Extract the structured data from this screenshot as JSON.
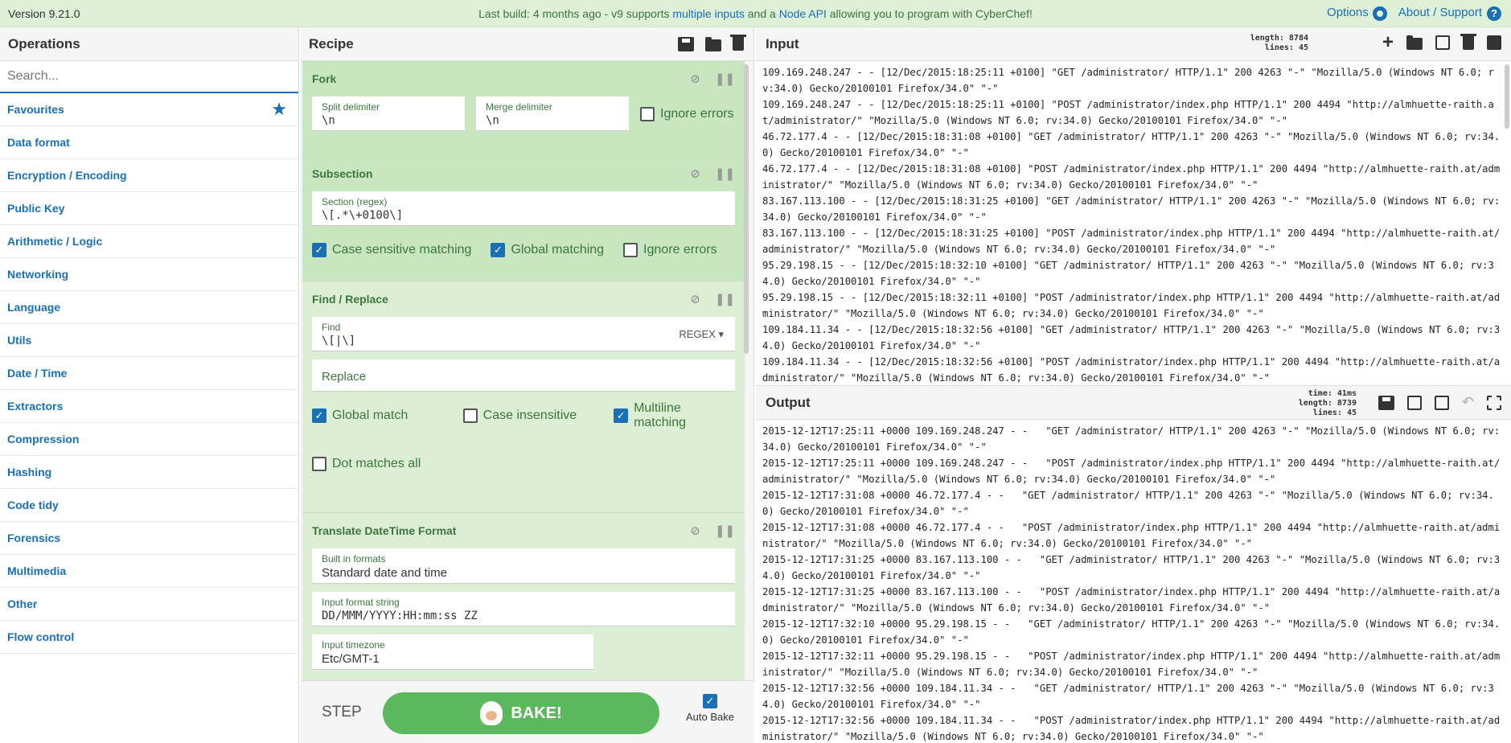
{
  "banner": {
    "version": "Version 9.21.0",
    "center_pre": "Last build: 4 months ago - v9 supports ",
    "center_link1": "multiple inputs",
    "center_mid": " and a ",
    "center_link2": "Node API",
    "center_post": " allowing you to program with CyberChef!",
    "options": "Options",
    "about": "About / Support"
  },
  "operations": {
    "title": "Operations",
    "search_placeholder": "Search...",
    "categories": [
      "Favourites",
      "Data format",
      "Encryption / Encoding",
      "Public Key",
      "Arithmetic / Logic",
      "Networking",
      "Language",
      "Utils",
      "Date / Time",
      "Extractors",
      "Compression",
      "Hashing",
      "Code tidy",
      "Forensics",
      "Multimedia",
      "Other",
      "Flow control"
    ]
  },
  "recipe": {
    "title": "Recipe",
    "fork": {
      "title": "Fork",
      "split_label": "Split delimiter",
      "split_value": "\\n",
      "merge_label": "Merge delimiter",
      "merge_value": "\\n",
      "ignore_errors": "Ignore errors"
    },
    "subsection": {
      "title": "Subsection",
      "section_label": "Section (regex)",
      "section_value": "\\[.*\\+0100\\]",
      "case_sensitive": "Case sensitive matching",
      "global": "Global matching",
      "ignore_errors": "Ignore errors"
    },
    "find_replace": {
      "title": "Find / Replace",
      "find_label": "Find",
      "find_value": "\\[|\\]",
      "regex_label": "REGEX",
      "replace_placeholder": "Replace",
      "global": "Global match",
      "case_insensitive": "Case insensitive",
      "multiline": "Multiline matching",
      "dot_all": "Dot matches all"
    },
    "translate": {
      "title": "Translate DateTime Format",
      "builtin_label": "Built in formats",
      "builtin_value": "Standard date and time",
      "input_format_label": "Input format string",
      "input_format_value": "DD/MMM/YYYY:HH:mm:ss ZZ",
      "tz_label": "Input timezone",
      "tz_value": "Etc/GMT-1"
    },
    "step": "STEP",
    "bake": "BAKE!",
    "auto_bake": "Auto Bake"
  },
  "input": {
    "title": "Input",
    "length_label": "length:",
    "length": "8784",
    "lines_label": "lines:",
    "lines": "45",
    "text": "109.169.248.247 - - [12/Dec/2015:18:25:11 +0100] \"GET /administrator/ HTTP/1.1\" 200 4263 \"-\" \"Mozilla/5.0 (Windows NT 6.0; rv:34.0) Gecko/20100101 Firefox/34.0\" \"-\"\n109.169.248.247 - - [12/Dec/2015:18:25:11 +0100] \"POST /administrator/index.php HTTP/1.1\" 200 4494 \"http://almhuette-raith.at/administrator/\" \"Mozilla/5.0 (Windows NT 6.0; rv:34.0) Gecko/20100101 Firefox/34.0\" \"-\"\n46.72.177.4 - - [12/Dec/2015:18:31:08 +0100] \"GET /administrator/ HTTP/1.1\" 200 4263 \"-\" \"Mozilla/5.0 (Windows NT 6.0; rv:34.0) Gecko/20100101 Firefox/34.0\" \"-\"\n46.72.177.4 - - [12/Dec/2015:18:31:08 +0100] \"POST /administrator/index.php HTTP/1.1\" 200 4494 \"http://almhuette-raith.at/administrator/\" \"Mozilla/5.0 (Windows NT 6.0; rv:34.0) Gecko/20100101 Firefox/34.0\" \"-\"\n83.167.113.100 - - [12/Dec/2015:18:31:25 +0100] \"GET /administrator/ HTTP/1.1\" 200 4263 \"-\" \"Mozilla/5.0 (Windows NT 6.0; rv:34.0) Gecko/20100101 Firefox/34.0\" \"-\"\n83.167.113.100 - - [12/Dec/2015:18:31:25 +0100] \"POST /administrator/index.php HTTP/1.1\" 200 4494 \"http://almhuette-raith.at/administrator/\" \"Mozilla/5.0 (Windows NT 6.0; rv:34.0) Gecko/20100101 Firefox/34.0\" \"-\"\n95.29.198.15 - - [12/Dec/2015:18:32:10 +0100] \"GET /administrator/ HTTP/1.1\" 200 4263 \"-\" \"Mozilla/5.0 (Windows NT 6.0; rv:34.0) Gecko/20100101 Firefox/34.0\" \"-\"\n95.29.198.15 - - [12/Dec/2015:18:32:11 +0100] \"POST /administrator/index.php HTTP/1.1\" 200 4494 \"http://almhuette-raith.at/administrator/\" \"Mozilla/5.0 (Windows NT 6.0; rv:34.0) Gecko/20100101 Firefox/34.0\" \"-\"\n109.184.11.34 - - [12/Dec/2015:18:32:56 +0100] \"GET /administrator/ HTTP/1.1\" 200 4263 \"-\" \"Mozilla/5.0 (Windows NT 6.0; rv:34.0) Gecko/20100101 Firefox/34.0\" \"-\"\n109.184.11.34 - - [12/Dec/2015:18:32:56 +0100] \"POST /administrator/index.php HTTP/1.1\" 200 4494 \"http://almhuette-raith.at/administrator/\" \"Mozilla/5.0 (Windows NT 6.0; rv:34.0) Gecko/20100101 Firefox/34.0\" \"-\""
  },
  "output": {
    "title": "Output",
    "time_label": "time:",
    "time": "41ms",
    "length_label": "length:",
    "length": "8739",
    "lines_label": "lines:",
    "lines": "45",
    "text": "2015-12-12T17:25:11 +0000 109.169.248.247 - -   \"GET /administrator/ HTTP/1.1\" 200 4263 \"-\" \"Mozilla/5.0 (Windows NT 6.0; rv:34.0) Gecko/20100101 Firefox/34.0\" \"-\"\n2015-12-12T17:25:11 +0000 109.169.248.247 - -   \"POST /administrator/index.php HTTP/1.1\" 200 4494 \"http://almhuette-raith.at/administrator/\" \"Mozilla/5.0 (Windows NT 6.0; rv:34.0) Gecko/20100101 Firefox/34.0\" \"-\"\n2015-12-12T17:31:08 +0000 46.72.177.4 - -   \"GET /administrator/ HTTP/1.1\" 200 4263 \"-\" \"Mozilla/5.0 (Windows NT 6.0; rv:34.0) Gecko/20100101 Firefox/34.0\" \"-\"\n2015-12-12T17:31:08 +0000 46.72.177.4 - -   \"POST /administrator/index.php HTTP/1.1\" 200 4494 \"http://almhuette-raith.at/administrator/\" \"Mozilla/5.0 (Windows NT 6.0; rv:34.0) Gecko/20100101 Firefox/34.0\" \"-\"\n2015-12-12T17:31:25 +0000 83.167.113.100 - -   \"GET /administrator/ HTTP/1.1\" 200 4263 \"-\" \"Mozilla/5.0 (Windows NT 6.0; rv:34.0) Gecko/20100101 Firefox/34.0\" \"-\"\n2015-12-12T17:31:25 +0000 83.167.113.100 - -   \"POST /administrator/index.php HTTP/1.1\" 200 4494 \"http://almhuette-raith.at/administrator/\" \"Mozilla/5.0 (Windows NT 6.0; rv:34.0) Gecko/20100101 Firefox/34.0\" \"-\"\n2015-12-12T17:32:10 +0000 95.29.198.15 - -   \"GET /administrator/ HTTP/1.1\" 200 4263 \"-\" \"Mozilla/5.0 (Windows NT 6.0; rv:34.0) Gecko/20100101 Firefox/34.0\" \"-\"\n2015-12-12T17:32:11 +0000 95.29.198.15 - -   \"POST /administrator/index.php HTTP/1.1\" 200 4494 \"http://almhuette-raith.at/administrator/\" \"Mozilla/5.0 (Windows NT 6.0; rv:34.0) Gecko/20100101 Firefox/34.0\" \"-\"\n2015-12-12T17:32:56 +0000 109.184.11.34 - -   \"GET /administrator/ HTTP/1.1\" 200 4263 \"-\" \"Mozilla/5.0 (Windows NT 6.0; rv:34.0) Gecko/20100101 Firefox/34.0\" \"-\"\n2015-12-12T17:32:56 +0000 109.184.11.34 - -   \"POST /administrator/index.php HTTP/1.1\" 200 4494 \"http://almhuette-raith.at/administrator/\" \"Mozilla/5.0 (Windows NT 6.0; rv:34.0) Gecko/20100101 Firefox/34.0\" \"-\""
  }
}
